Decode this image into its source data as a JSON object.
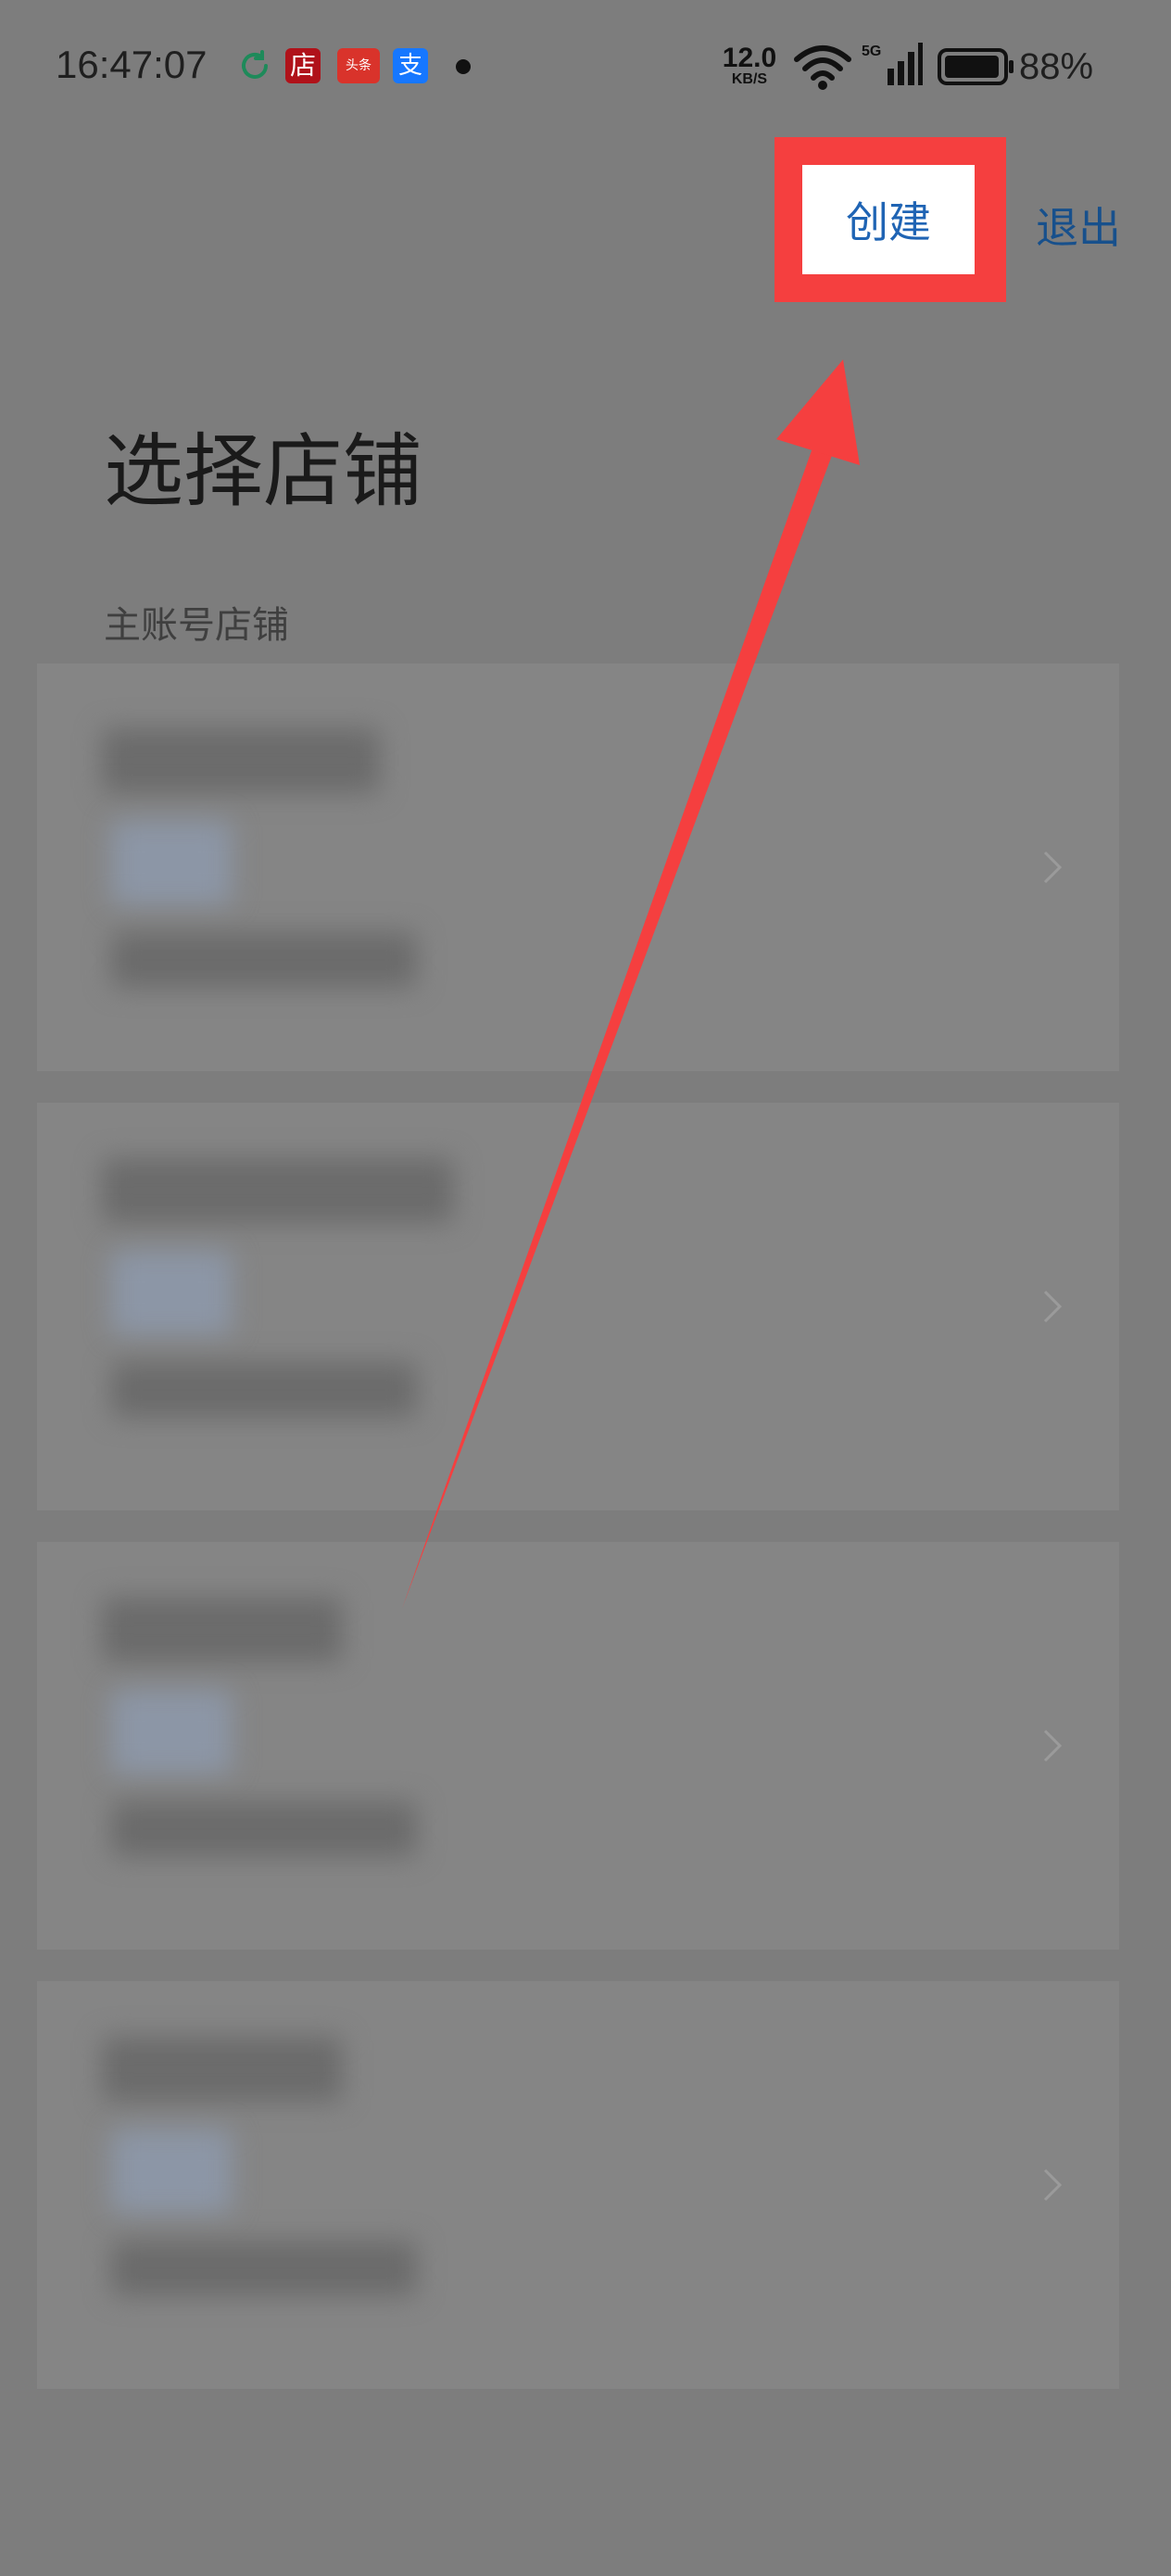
{
  "status_bar": {
    "time": "16:47:07",
    "notification_icons": [
      "sync-icon",
      "shop-app-icon",
      "toutiao-icon",
      "alipay-icon"
    ],
    "toutiao_label": "头条",
    "shop_label": "店",
    "alipay_label": "支",
    "net_speed_value": "12.0",
    "net_speed_unit": "KB/S",
    "network_type": "5G",
    "battery": "88%"
  },
  "header": {
    "create_label": "创建",
    "exit_label": "退出"
  },
  "page": {
    "title": "选择店铺",
    "section_label": "主账号店铺"
  },
  "store_cards": [
    {
      "name": "",
      "obscured": true
    },
    {
      "name": "",
      "obscured": true
    },
    {
      "name": "",
      "obscured": true
    },
    {
      "name": "",
      "obscured": true
    }
  ],
  "colors": {
    "overlay_background": "#7d7d7d",
    "annotation_red": "#f53f3f",
    "link_blue": "#1f64b4"
  }
}
